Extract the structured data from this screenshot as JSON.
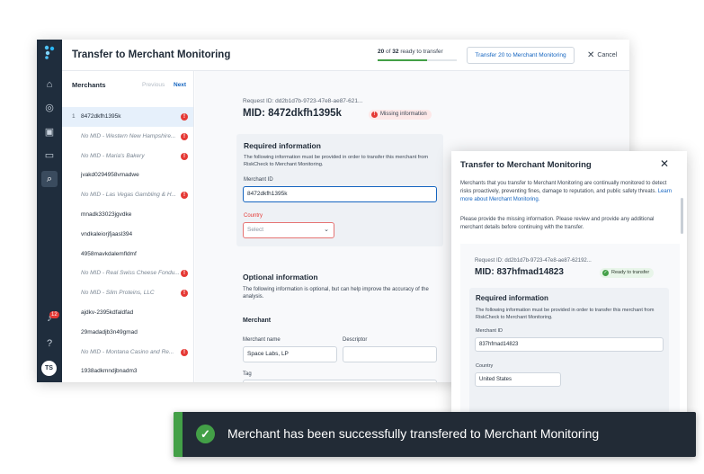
{
  "app": {
    "title": "Transfer to Merchant Monitoring",
    "progress": {
      "ready": "20",
      "total": "32",
      "of": "of",
      "text": "ready to transfer",
      "fraction": 0.625
    },
    "transfer_button": "Transfer 20 to Merchant Monitoring",
    "cancel_button": "Cancel"
  },
  "rail": {
    "icons": [
      "logo-icon",
      "home-icon",
      "check-circle-icon",
      "document-search-icon",
      "monitor-icon",
      "search-icon",
      "bell-icon",
      "help-icon"
    ],
    "notification_count": "12",
    "avatar": "TS"
  },
  "sidebar": {
    "heading": "Merchants",
    "previous": "Previous",
    "next": "Next",
    "merchants": [
      {
        "num": "1",
        "name": "8472dkfh1395k",
        "nomid": false,
        "error": true
      },
      {
        "num": "",
        "name": "No MID - Western New Hampshire...",
        "nomid": true,
        "error": true
      },
      {
        "num": "",
        "name": "No MID - Maria's Bakery",
        "nomid": true,
        "error": true
      },
      {
        "num": "",
        "name": "jvakd0294958vmadwe",
        "nomid": false,
        "error": false
      },
      {
        "num": "",
        "name": "No MID - Las Vegas Gambling & H...",
        "nomid": true,
        "error": true
      },
      {
        "num": "",
        "name": "mnadk33023jgvdke",
        "nomid": false,
        "error": false
      },
      {
        "num": "",
        "name": "vndkaleiorjfjaasl394",
        "nomid": false,
        "error": false
      },
      {
        "num": "",
        "name": "4958mavkdalemfldmf",
        "nomid": false,
        "error": false
      },
      {
        "num": "",
        "name": "No MID - Real Swiss Cheese Fondu...",
        "nomid": true,
        "error": true
      },
      {
        "num": "",
        "name": "No MID - Slim Proteins, LLC",
        "nomid": true,
        "error": true
      },
      {
        "num": "",
        "name": "ajdkv-2395kdfaldfad",
        "nomid": false,
        "error": false
      },
      {
        "num": "",
        "name": "29madadjb3n49gmad",
        "nomid": false,
        "error": false
      },
      {
        "num": "",
        "name": "No MID - Montana Casino and Re...",
        "nomid": true,
        "error": true
      },
      {
        "num": "",
        "name": "1938adkmndjbnadm3",
        "nomid": false,
        "error": false
      }
    ]
  },
  "detail": {
    "request_id": "Request ID: dd2b1d7b-9723-47e8-ae87-621...",
    "mid": "MID: 8472dkfh1395k",
    "status": "Missing information",
    "required": {
      "heading": "Required information",
      "description": "The following information must be provided in order to transfer this merchant from RiskCheck to Merchant Monitoring.",
      "merchant_id_label": "Merchant ID",
      "merchant_id_value": "8472dkfh1395k",
      "country_label": "Country",
      "country_placeholder": "Select"
    },
    "optional": {
      "heading": "Optional information",
      "description": "The following information is optional, but can help improve the accuracy of the analysis.",
      "merchant_heading": "Merchant",
      "merchant_name_label": "Merchant name",
      "merchant_name_value": "Space Labs, LP",
      "descriptor_label": "Descriptor",
      "descriptor_value": "",
      "tag_label": "Tag"
    }
  },
  "modal": {
    "title": "Transfer to Merchant Monitoring",
    "paragraph1": "Merchants that you transfer to Merchant Monitoring are continually monitored to detect risks proactively, preventing fines, damage to reputation, and public safety threats.",
    "learn_more": "Learn more about Merchant Monitoring.",
    "paragraph2": "Please provide the missing information. Please review and provide any additional merchant details before continuing with the transfer.",
    "request_id": "Request ID: dd2b1d7b-9723-47e8-ae87-62192...",
    "mid": "MID: 837hfmad14823",
    "status": "Ready to transfer",
    "required": {
      "heading": "Required information",
      "description": "The following information must be provided in order to transfer this merchant from RiskCheck to Merchant Monitoring.",
      "merchant_id_label": "Merchant ID",
      "merchant_id_value": "837hfmad14823",
      "country_label": "Country",
      "country_value": "United States"
    }
  },
  "toast": {
    "message": "Merchant has been successfully transfered to Merchant Monitoring"
  },
  "colors": {
    "accent": "#1565c0",
    "success": "#43a047",
    "error": "#e53935",
    "rail": "#1f2d3d",
    "toast_bg": "#222b36"
  }
}
